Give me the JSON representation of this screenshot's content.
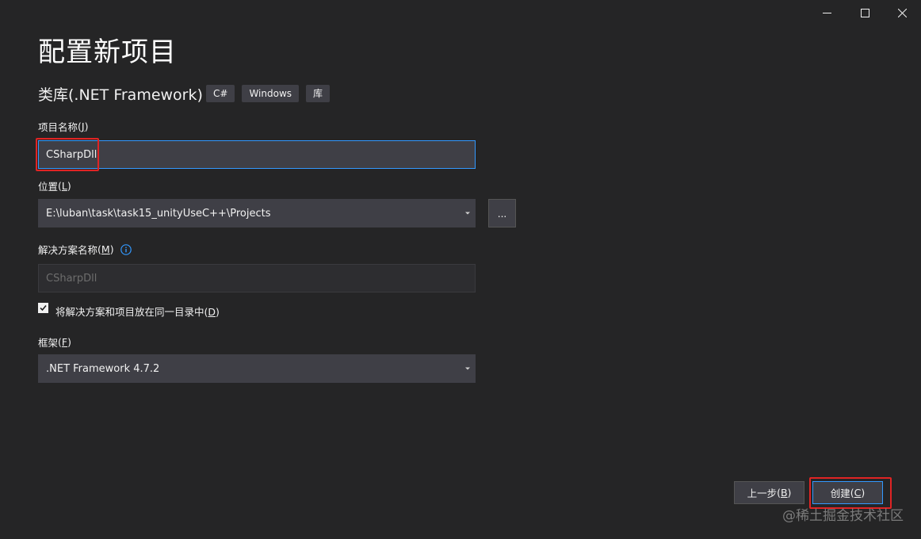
{
  "window": {
    "minimize_icon": "minimize-icon",
    "maximize_icon": "maximize-icon",
    "close_icon": "close-icon"
  },
  "page_title": "配置新项目",
  "template": {
    "name": "类库(.NET Framework)",
    "tags": [
      "C#",
      "Windows",
      "库"
    ]
  },
  "project_name": {
    "label": "项目名称",
    "hotkey": "J",
    "value": "CSharpDll"
  },
  "location": {
    "label": "位置",
    "hotkey": "L",
    "value": "E:\\luban\\task\\task15_unityUseC++\\Projects",
    "browse_label": "..."
  },
  "solution_name": {
    "label": "解决方案名称",
    "hotkey": "M",
    "placeholder": "CSharpDll",
    "info_icon": "info-icon"
  },
  "same_directory": {
    "checked": true,
    "label": "将解决方案和项目放在同一目录中",
    "hotkey": "D"
  },
  "framework": {
    "label": "框架",
    "hotkey": "F",
    "value": ".NET Framework 4.7.2"
  },
  "footer": {
    "back_label": "上一步",
    "back_hotkey": "B",
    "create_label": "创建",
    "create_hotkey": "C"
  },
  "watermark": "@稀土掘金技术社区",
  "colors": {
    "background": "#252526",
    "field": "#3f3f46",
    "focus": "#3399ff",
    "highlight": "#e02424"
  }
}
